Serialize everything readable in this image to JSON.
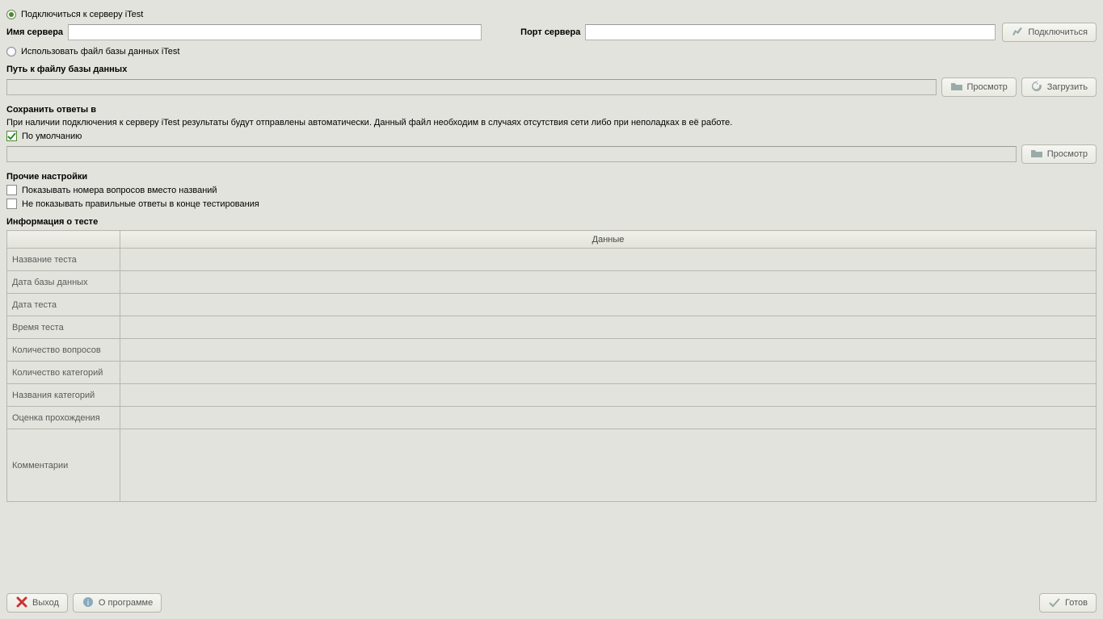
{
  "connection": {
    "radio_connect": "Подключиться к серверу iTest",
    "server_name_label": "Имя сервера",
    "server_port_label": "Порт сервера",
    "connect_btn": "Подключиться",
    "radio_file": "Использовать файл базы данных iTest"
  },
  "dbpath": {
    "label": "Путь к файлу базы данных",
    "browse_btn": "Просмотр",
    "load_btn": "Загрузить"
  },
  "save": {
    "label": "Сохранить ответы в",
    "hint": "При наличии подключения к серверу iTest результаты будут отправлены автоматически. Данный файл необходим в случаях отсутствия сети либо при неполадках в её работе.",
    "default_check": "По умолчанию",
    "browse_btn": "Просмотр"
  },
  "options": {
    "label": "Прочие настройки",
    "opt_show_numbers": "Показывать номера вопросов вместо названий",
    "opt_hide_answers": "Не показывать правильные ответы в конце тестирования"
  },
  "testinfo": {
    "label": "Информация о тесте",
    "col_key_header": "",
    "col_data_header": "Данные",
    "rows": [
      {
        "k": "Название теста",
        "v": ""
      },
      {
        "k": "Дата базы данных",
        "v": ""
      },
      {
        "k": "Дата теста",
        "v": ""
      },
      {
        "k": "Время теста",
        "v": ""
      },
      {
        "k": "Количество вопросов",
        "v": ""
      },
      {
        "k": "Количество категорий",
        "v": ""
      },
      {
        "k": "Названия категорий",
        "v": ""
      },
      {
        "k": "Оценка прохождения",
        "v": ""
      },
      {
        "k": "Комментарии",
        "v": ""
      }
    ]
  },
  "footer": {
    "exit_btn": "Выход",
    "about_btn": "О программе",
    "ready_btn": "Готов"
  }
}
